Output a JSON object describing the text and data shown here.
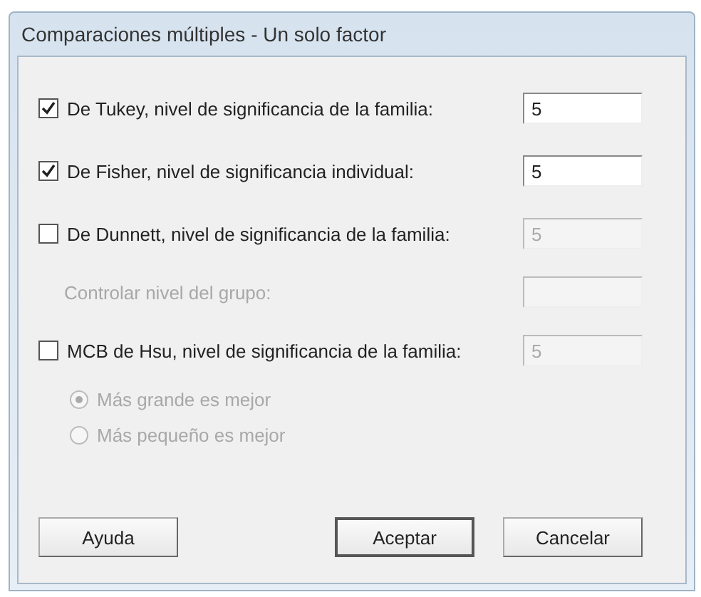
{
  "window": {
    "title": "Comparaciones múltiples - Un solo factor"
  },
  "options": [
    {
      "kind": "checkbox",
      "label": "De Tukey, nivel de significancia de la familia:",
      "checked": true,
      "value": "5",
      "field_disabled": false
    },
    {
      "kind": "checkbox",
      "label": "De Fisher, nivel de significancia individual:",
      "checked": true,
      "value": "5",
      "field_disabled": false
    },
    {
      "kind": "checkbox",
      "label": "De Dunnett, nivel de significancia de la familia:",
      "checked": false,
      "value": "5",
      "field_disabled": true
    },
    {
      "kind": "field",
      "label": "Controlar nivel del grupo:",
      "disabled": true
    },
    {
      "kind": "checkbox",
      "label": "MCB de Hsu, nivel de significancia de la familia:",
      "checked": false,
      "value": "5",
      "field_disabled": true
    },
    {
      "kind": "radio",
      "label": "Más grande es mejor",
      "selected": true,
      "disabled": true
    },
    {
      "kind": "radio",
      "label": "Más pequeño es mejor",
      "selected": false,
      "disabled": true
    }
  ],
  "buttons": [
    {
      "label": "Ayuda",
      "default": false
    },
    {
      "label": "Aceptar",
      "default": true
    },
    {
      "label": "Cancelar",
      "default": false
    }
  ]
}
